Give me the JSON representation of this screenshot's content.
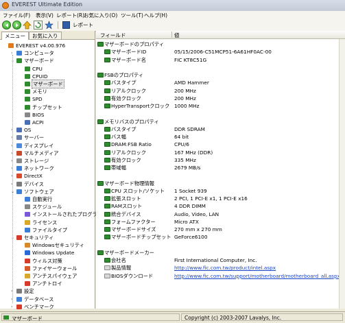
{
  "window": {
    "title": "EVEREST Ultimate Edition"
  },
  "menu": [
    "ファイル(F)",
    "表示(V)",
    "レポート(R)",
    "お気に入り(O)",
    "ツール(T)",
    "ヘルプ(H)"
  ],
  "toolbar": {
    "report_label": "レポート"
  },
  "tabs": [
    "メニュー",
    "お気に入り"
  ],
  "tree": [
    {
      "label": "EVEREST v4.00.976",
      "icon_color": "#e07a1a"
    },
    {
      "label": "コンピュータ",
      "icon_color": "#3a7ed8"
    },
    {
      "label": "マザーボード",
      "icon_color": "#2e8b2e"
    },
    {
      "label": "CPU",
      "icon_color": "#2e8b2e"
    },
    {
      "label": "CPUID",
      "icon_color": "#2e8b2e"
    },
    {
      "label": "マザーボード",
      "icon_color": "#2e8b2e"
    },
    {
      "label": "メモリ",
      "icon_color": "#2e8b2e"
    },
    {
      "label": "SPD",
      "icon_color": "#2e8b2e"
    },
    {
      "label": "チップセット",
      "icon_color": "#2e8b2e"
    },
    {
      "label": "BIOS",
      "icon_color": "#888888"
    },
    {
      "label": "ACPI",
      "icon_color": "#4a6fb8"
    },
    {
      "label": "OS",
      "icon_color": "#4a6fb8"
    },
    {
      "label": "サーバー",
      "icon_color": "#6a7fa8"
    },
    {
      "label": "ディスプレイ",
      "icon_color": "#4a8ad8"
    },
    {
      "label": "マルチメディア",
      "icon_color": "#c84a2a"
    },
    {
      "label": "ストレージ",
      "icon_color": "#888888"
    },
    {
      "label": "ネットワーク",
      "icon_color": "#3a7ed8"
    },
    {
      "label": "DirectX",
      "icon_color": "#d84a2a"
    },
    {
      "label": "デバイス",
      "icon_color": "#7a7a7a"
    },
    {
      "label": "ソフトウェア",
      "icon_color": "#3a7ed8"
    },
    {
      "label": "自動実行",
      "icon_color": "#3a7ed8"
    },
    {
      "label": "スケジュール",
      "icon_color": "#888888"
    },
    {
      "label": "インストールされたプログラム",
      "icon_color": "#7a5ad8"
    },
    {
      "label": "ライセンス",
      "icon_color": "#d8a82a"
    },
    {
      "label": "ファイルタイプ",
      "icon_color": "#3a7ed8"
    },
    {
      "label": "セキュリティ",
      "icon_color": "#d83a2a"
    },
    {
      "label": "Windowsセキュリティ",
      "icon_color": "#d88a2a"
    },
    {
      "label": "Windows Update",
      "icon_color": "#2a6ad8"
    },
    {
      "label": "ウィルス対策",
      "icon_color": "#d83a2a"
    },
    {
      "label": "ファイヤーウォール",
      "icon_color": "#d85a2a"
    },
    {
      "label": "アンチスパイウェア",
      "icon_color": "#d8a82a"
    },
    {
      "label": "アンチトロイ",
      "icon_color": "#d83a2a"
    },
    {
      "label": "設定",
      "icon_color": "#7a7a7a"
    },
    {
      "label": "データベース",
      "icon_color": "#3a7ed8"
    },
    {
      "label": "ベンチマーク",
      "icon_color": "#d83a2a"
    }
  ],
  "columns": {
    "field": "フィールド",
    "value": "値"
  },
  "rows": [
    {
      "type": "section",
      "f": "マザーボードのプロパティ",
      "v": ""
    },
    {
      "type": "item",
      "f": "マザーボードID",
      "v": "05/15/2006-C51MCP51-6A61HF0AC-00"
    },
    {
      "type": "item",
      "f": "マザーボード名",
      "v": "FIC KT8C51G"
    },
    {
      "type": "blank",
      "f": "",
      "v": ""
    },
    {
      "type": "section",
      "f": "FSBのプロパティ",
      "v": ""
    },
    {
      "type": "item",
      "f": "バスタイプ",
      "v": "AMD Hammer"
    },
    {
      "type": "item",
      "f": "リアルクロック",
      "v": "200 MHz"
    },
    {
      "type": "item",
      "f": "有効クロック",
      "v": "200 MHz"
    },
    {
      "type": "item",
      "f": "HyperTransportクロック",
      "v": "1000 MHz"
    },
    {
      "type": "blank",
      "f": "",
      "v": ""
    },
    {
      "type": "section",
      "f": "メモリバスのプロパティ",
      "v": ""
    },
    {
      "type": "item",
      "f": "バスタイプ",
      "v": "DDR SDRAM"
    },
    {
      "type": "item",
      "f": "バス幅",
      "v": "64 bit"
    },
    {
      "type": "item",
      "f": "DRAM:FSB Ratio",
      "v": "CPU/6"
    },
    {
      "type": "item",
      "f": "リアルクロック",
      "v": "167 MHz (DDR)"
    },
    {
      "type": "item",
      "f": "有効クロック",
      "v": "335 MHz"
    },
    {
      "type": "item",
      "f": "帯域幅",
      "v": "2679 MB/s"
    },
    {
      "type": "blank",
      "f": "",
      "v": ""
    },
    {
      "type": "section",
      "f": "マザーボード物理情報",
      "v": ""
    },
    {
      "type": "item",
      "f": "CPU スロット/ソケット",
      "v": "1 Socket 939"
    },
    {
      "type": "item",
      "f": "拡張スロット",
      "v": "2 PCI, 1 PCI-E x1, 1 PCI-E x16"
    },
    {
      "type": "item",
      "f": "RAMスロット",
      "v": "4 DDR DIMM"
    },
    {
      "type": "item",
      "f": "統合デバイス",
      "v": "Audio, Video, LAN"
    },
    {
      "type": "item",
      "f": "フォームファクター",
      "v": "Micro ATX"
    },
    {
      "type": "item",
      "f": "マザーボードサイズ",
      "v": "270 mm x 270 mm"
    },
    {
      "type": "item",
      "f": "マザーボードチップセット",
      "v": "GeForce6100"
    },
    {
      "type": "blank",
      "f": "",
      "v": ""
    },
    {
      "type": "section",
      "f": "マザーボードメーカー",
      "v": ""
    },
    {
      "type": "item",
      "f": "会社名",
      "v": "First International Computer, Inc."
    },
    {
      "type": "link",
      "f": "製品情報",
      "v": "http://www.fic.com.tw/product/intel.aspx"
    },
    {
      "type": "link",
      "f": "BIOSダウンロード",
      "v": "http://www.fic.com.tw/support/motherboard/motherboard_all.aspx"
    }
  ],
  "statusbar": {
    "left": "マザーボード",
    "right": "Copyright (c) 2003-2007 Lavalys, Inc."
  }
}
